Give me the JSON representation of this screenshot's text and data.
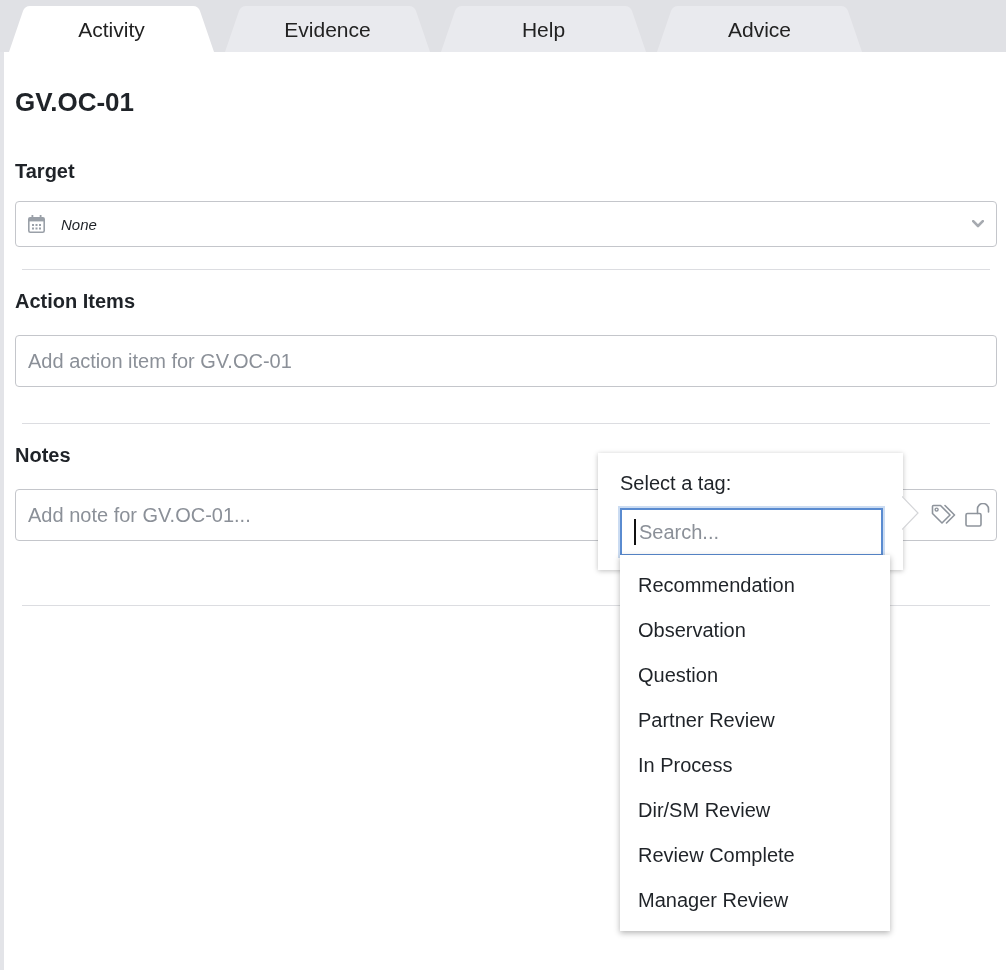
{
  "tabs": [
    {
      "label": "Activity",
      "selected": true
    },
    {
      "label": "Evidence",
      "selected": false
    },
    {
      "label": "Help",
      "selected": false
    },
    {
      "label": "Advice",
      "selected": false
    }
  ],
  "title": "GV.OC-01",
  "target": {
    "label": "Target",
    "value": "None"
  },
  "action_items": {
    "label": "Action Items",
    "placeholder": "Add action item for GV.OC-01"
  },
  "notes": {
    "label": "Notes",
    "placeholder": "Add note for GV.OC-01..."
  },
  "tag_popover": {
    "title": "Select a tag:",
    "search": {
      "placeholder": "Search...",
      "focused": true
    },
    "options": [
      "Recommendation",
      "Observation",
      "Question",
      "Partner Review",
      "In Process",
      "Dir/SM Review",
      "Review Complete",
      "Manager Review"
    ]
  }
}
